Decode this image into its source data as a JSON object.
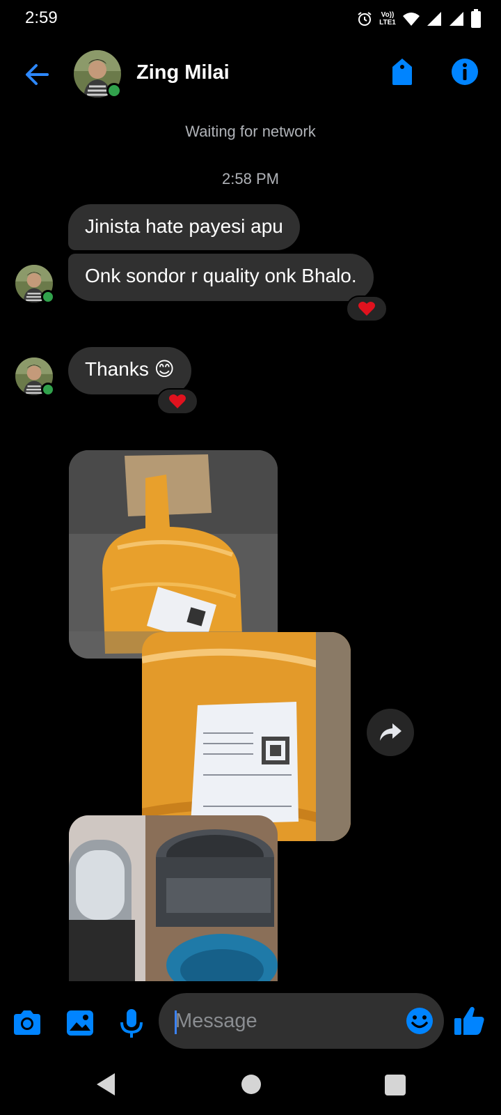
{
  "status_bar": {
    "time": "2:59",
    "lte_top": "Vo))",
    "lte_bottom": "LTE1",
    "icons": [
      "alarm-icon",
      "volte-icon",
      "wifi-icon",
      "signal-icon",
      "signal-icon",
      "battery-icon"
    ]
  },
  "header": {
    "contact_name": "Zing Milai",
    "online": true,
    "icons": [
      "back-arrow-icon",
      "tag-icon",
      "info-icon"
    ]
  },
  "network_status": "Waiting for network",
  "timestamp": "2:58 PM",
  "messages": [
    {
      "text": "Jinista hate payesi apu",
      "sender": "contact"
    },
    {
      "text": "Onk sondor r quality onk Bhalo.",
      "sender": "contact",
      "reaction": "❤️"
    },
    {
      "text": "Thanks 😊",
      "sender": "contact",
      "reaction": "❤️"
    }
  ],
  "attachments": [
    "photo",
    "photo",
    "photo"
  ],
  "composer": {
    "placeholder": "Message",
    "value": "",
    "icons": [
      "camera-icon",
      "image-icon",
      "microphone-icon",
      "emoji-icon",
      "thumbs-up-icon"
    ]
  },
  "colors": {
    "accent": "#0084ff",
    "bubble": "#303030",
    "background": "#000000",
    "secondary_text": "#b0b3b8",
    "online": "#31a24c"
  }
}
